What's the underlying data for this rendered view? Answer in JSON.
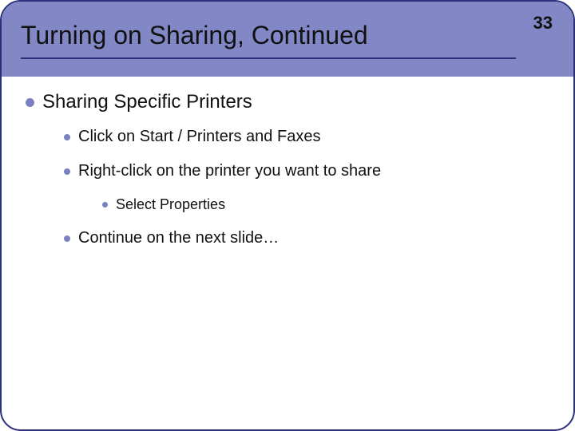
{
  "slide": {
    "title": "Turning on Sharing, Continued",
    "page_number": "33",
    "bullets": {
      "lvl1": "Sharing Specific Printers",
      "lvl2a": "Click on Start / Printers and Faxes",
      "lvl2b": "Right-click on the printer you want to share",
      "lvl3a": "Select Properties",
      "lvl2c": "Continue on the next slide…"
    }
  }
}
